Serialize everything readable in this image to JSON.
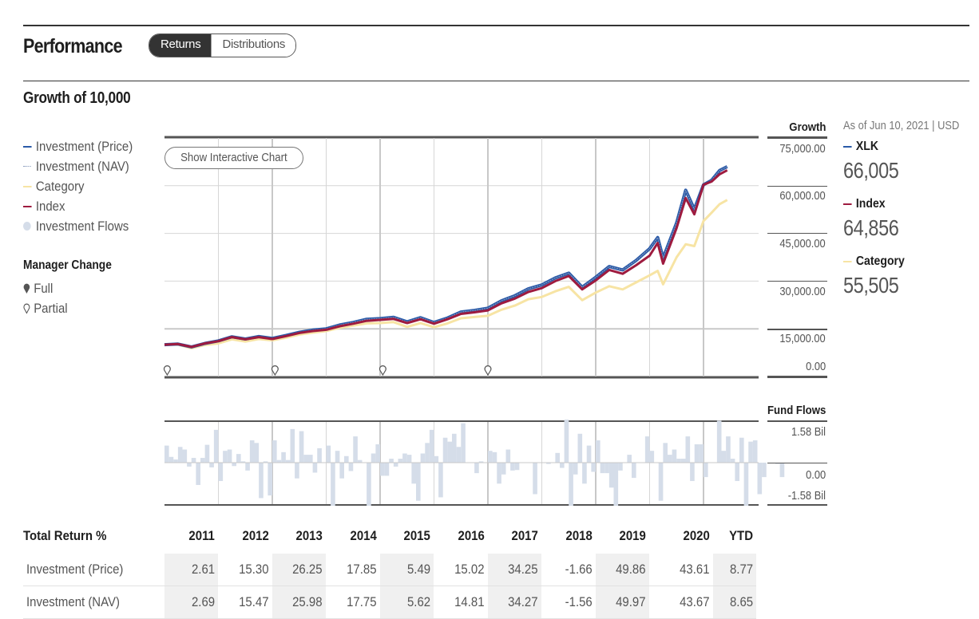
{
  "header": {
    "title": "Performance",
    "tabs": [
      {
        "label": "Returns",
        "active": true
      },
      {
        "label": "Distributions",
        "active": false
      }
    ]
  },
  "section_title": "Growth of 10,000",
  "legend": {
    "items": [
      {
        "label": "Investment (Price)",
        "color": "#2a5aa8",
        "style": "line"
      },
      {
        "label": "Investment (NAV)",
        "color": "#8fa0c0",
        "style": "dotted"
      },
      {
        "label": "Category",
        "color": "#f7e4a4",
        "style": "line"
      },
      {
        "label": "Index",
        "color": "#9e1b3f",
        "style": "line"
      },
      {
        "label": "Investment Flows",
        "color": "#d5dde9",
        "style": "dot"
      }
    ],
    "manager_change": {
      "title": "Manager Change",
      "full": "Full",
      "partial": "Partial"
    }
  },
  "interactive_button": "Show Interactive Chart",
  "summary": {
    "as_of": "As of Jun 10, 2021 | USD",
    "items": [
      {
        "name": "XLK",
        "value": "66,005",
        "color": "#2a5aa8"
      },
      {
        "name": "Index",
        "value": "64,856",
        "color": "#9e1b3f"
      },
      {
        "name": "Category",
        "value": "55,505",
        "color": "#f7e4a4"
      }
    ]
  },
  "chart_data": [
    {
      "type": "line",
      "title": "Growth of 10,000",
      "ylabel": "Growth",
      "y_tick_labels": [
        "75,000.00",
        "60,000.00",
        "45,000.00",
        "30,000.00",
        "15,000.00",
        "0.00"
      ],
      "y_ticks": [
        75000,
        60000,
        45000,
        30000,
        15000,
        0
      ],
      "ylim": [
        0,
        75000
      ],
      "xlim": [
        2011.0,
        2021.5
      ],
      "grid": true,
      "legend": "left",
      "x": [
        2011.0,
        2011.25,
        2011.5,
        2011.75,
        2012.0,
        2012.25,
        2012.5,
        2012.75,
        2013.0,
        2013.25,
        2013.5,
        2013.75,
        2014.0,
        2014.25,
        2014.5,
        2014.75,
        2015.0,
        2015.25,
        2015.5,
        2015.75,
        2016.0,
        2016.25,
        2016.5,
        2016.75,
        2017.0,
        2017.25,
        2017.5,
        2017.75,
        2018.0,
        2018.25,
        2018.5,
        2018.75,
        2019.0,
        2019.25,
        2019.5,
        2019.75,
        2020.0,
        2020.15,
        2020.25,
        2020.5,
        2020.67,
        2020.83,
        2021.0,
        2021.15,
        2021.3,
        2021.44
      ],
      "series": [
        {
          "name": "Investment (Price)",
          "color": "#2a5aa8",
          "values": [
            10000,
            10200,
            9300,
            10400,
            11200,
            12500,
            11800,
            12600,
            12000,
            12900,
            13900,
            14600,
            15000,
            16200,
            17000,
            18000,
            18200,
            18600,
            17200,
            18500,
            17000,
            18400,
            20300,
            20800,
            21500,
            23800,
            25400,
            27600,
            28800,
            31000,
            32500,
            28100,
            31200,
            34600,
            33500,
            36500,
            40200,
            43700,
            37300,
            48300,
            58600,
            52600,
            60300,
            61700,
            64800,
            66005
          ]
        },
        {
          "name": "Investment (NAV)",
          "color": "#8fa0c0",
          "values": [
            10000,
            10200,
            9300,
            10400,
            11200,
            12500,
            11800,
            12600,
            12000,
            12900,
            13900,
            14600,
            15000,
            16200,
            17000,
            18000,
            18200,
            18600,
            17200,
            18500,
            17000,
            18400,
            20300,
            20800,
            21500,
            23800,
            25400,
            27600,
            28800,
            31000,
            32500,
            28100,
            31200,
            34600,
            33500,
            36500,
            40200,
            43700,
            37300,
            48300,
            58600,
            52600,
            60300,
            61700,
            64800,
            66000
          ]
        },
        {
          "name": "Category",
          "color": "#f7e4a4",
          "values": [
            10000,
            10000,
            8900,
            9900,
            10400,
            11700,
            11000,
            11800,
            11400,
            12200,
            13200,
            13800,
            14300,
            15300,
            16000,
            16700,
            16800,
            17100,
            15600,
            16800,
            15500,
            16700,
            18300,
            18700,
            19100,
            21000,
            22300,
            24300,
            25000,
            26800,
            28200,
            24000,
            26400,
            28400,
            27400,
            29600,
            31800,
            33200,
            29000,
            37500,
            41600,
            41000,
            48900,
            51500,
            54200,
            55505
          ]
        },
        {
          "name": "Index",
          "color": "#9e1b3f",
          "values": [
            10000,
            10200,
            9300,
            10400,
            11100,
            12400,
            11700,
            12400,
            11800,
            12700,
            13700,
            14300,
            14700,
            15800,
            16600,
            17500,
            17800,
            18100,
            16800,
            18000,
            16600,
            18000,
            19700,
            20200,
            20800,
            23000,
            24500,
            26600,
            27800,
            30000,
            31600,
            27400,
            30200,
            33500,
            32300,
            35000,
            38000,
            42000,
            35500,
            46700,
            56100,
            51000,
            60300,
            61300,
            63600,
            64856
          ]
        }
      ],
      "manager_changes": [
        {
          "x": 2011.05,
          "type": "partial"
        },
        {
          "x": 2013.05,
          "type": "partial"
        },
        {
          "x": 2015.05,
          "type": "partial"
        },
        {
          "x": 2017.0,
          "type": "partial"
        }
      ]
    },
    {
      "type": "bar",
      "title": "Fund Flows",
      "ylabel": "Fund Flows",
      "y_tick_labels": [
        "1.58 Bil",
        "0.00",
        "-1.58 Bil"
      ],
      "ylim": [
        -1.58,
        1.58
      ],
      "units": "Bil",
      "x_start": 2011.0,
      "step": "month",
      "values": [
        0.65,
        0.22,
        0.12,
        0.6,
        0.5,
        -0.15,
        0.18,
        -0.85,
        0.18,
        0.68,
        -0.18,
        1.25,
        -0.7,
        0.45,
        0.5,
        -0.13,
        0.33,
        0.05,
        -0.3,
        0.85,
        0.75,
        -1.35,
        0.05,
        -1.25,
        0.85,
        0.1,
        0.4,
        0.1,
        1.28,
        -0.6,
        1.2,
        0.3,
        0.3,
        -0.38,
        0.55,
        0.0,
        0.65,
        -2.8,
        0.45,
        -0.6,
        0.25,
        -0.32,
        1.0,
        0.1,
        0.0,
        -2.4,
        0.35,
        0.7,
        -0.5,
        -0.5,
        0.15,
        -0.15,
        0.15,
        0.35,
        0.3,
        -0.8,
        -1.45,
        0.35,
        0.75,
        1.25,
        0.25,
        -1.32,
        0.95,
        0.8,
        1.1,
        0.6,
        1.5,
        0.0,
        0.0,
        -0.4,
        0.05,
        0.0,
        0.45,
        0.4,
        -0.8,
        -0.45,
        0.5,
        -0.3,
        -0.28,
        0.0,
        0.0,
        0.0,
        -1.2,
        0.0,
        0.0,
        -0.05,
        0.0,
        0.37,
        -0.2,
        2.05,
        -1.9,
        -0.45,
        1.1,
        -0.8,
        0.65,
        -0.35,
        0.85,
        -0.4,
        -0.4,
        -0.95,
        -2.45,
        -0.3,
        0.0,
        0.3,
        -0.58,
        0.0,
        0.0,
        1.0,
        0.45,
        0.0,
        -1.45,
        0.75,
        0.3,
        0.5,
        0.15,
        0.15,
        1.0,
        -0.7,
        0.7,
        0.7,
        -0.55,
        0.0,
        0.0,
        1.6,
        0.45,
        1.0,
        0.15,
        -0.7,
        0.95,
        -2.45,
        0.8,
        0.85,
        -1.2,
        -0.55,
        0.0,
        0.0,
        -0.05,
        -0.55
      ]
    },
    {
      "type": "table",
      "title": "Total Return %",
      "columns": [
        "2011",
        "2012",
        "2013",
        "2014",
        "2015",
        "2016",
        "2017",
        "2018",
        "2019",
        "2020",
        "YTD"
      ],
      "rows": [
        {
          "label": "Investment (Price)",
          "values": [
            "2.61",
            "15.30",
            "26.25",
            "17.85",
            "5.49",
            "15.02",
            "34.25",
            "-1.66",
            "49.86",
            "43.61",
            "8.77"
          ]
        },
        {
          "label": "Investment (NAV)",
          "values": [
            "2.69",
            "15.47",
            "25.98",
            "17.75",
            "5.62",
            "14.81",
            "34.27",
            "-1.56",
            "49.97",
            "43.67",
            "8.65"
          ]
        }
      ]
    }
  ]
}
